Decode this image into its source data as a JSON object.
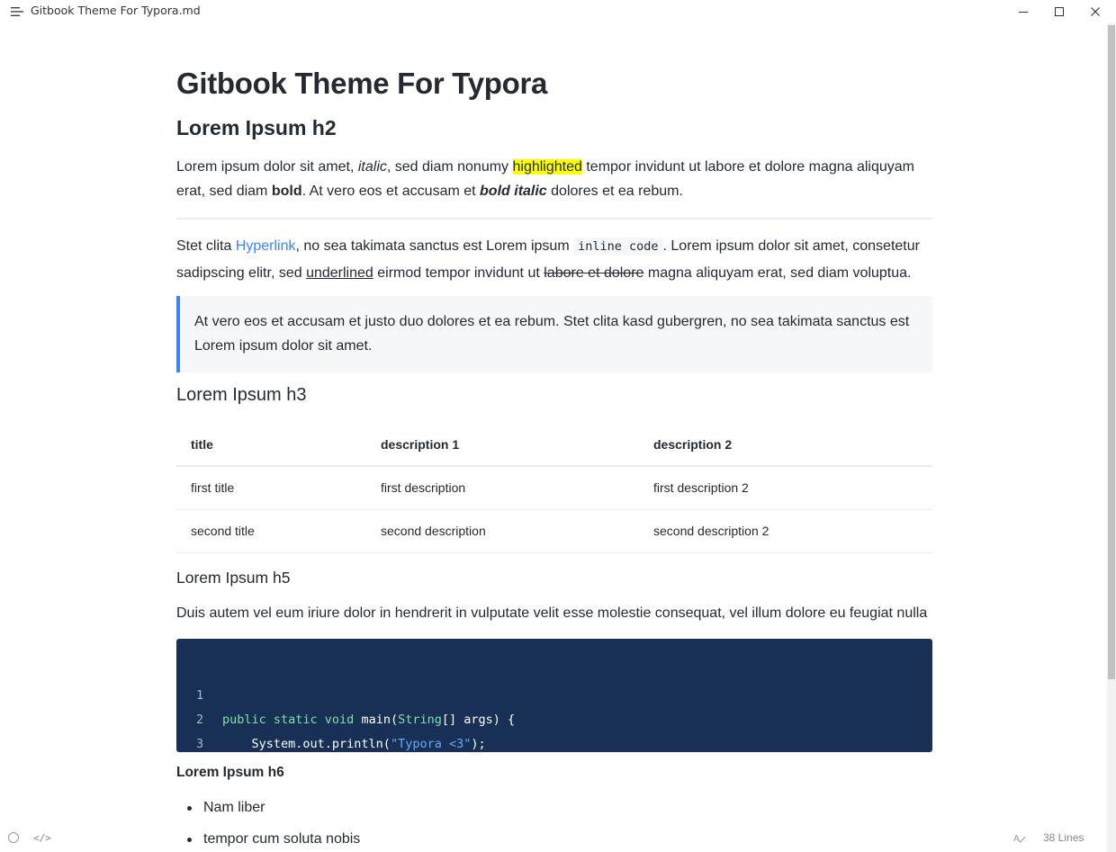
{
  "window": {
    "title": "Gitbook Theme For Typora.md",
    "minimize_icon": "minimize-icon",
    "maximize_icon": "maximize-icon",
    "close_icon": "close-icon"
  },
  "doc": {
    "h1": "Gitbook Theme For Typora",
    "h2": "Lorem Ipsum h2",
    "p1": {
      "a": "Lorem ipsum dolor sit amet, ",
      "italic": "italic",
      "b": ", sed diam nonumy ",
      "highlight": "highlighted",
      "c": " tempor invidunt ut labore et dolore magna aliquyam erat, sed diam ",
      "bold": "bold",
      "d": ". At vero eos et accusam et ",
      "bold_italic": "bold italic",
      "e": " dolores et ea rebum."
    },
    "p2": {
      "a": "Stet clita ",
      "link": "Hyperlink",
      "b": ", no sea takimata sanctus est Lorem ipsum ",
      "code": "inline code",
      "c": ". Lorem ipsum dolor sit amet, consetetur sadipscing elitr, sed ",
      "underline": "underlined",
      "d": " eirmod tempor invidunt ut ",
      "strike": "labore et dolore",
      "e": " magna aliquyam erat, sed diam voluptua."
    },
    "quote": "At vero eos et accusam et justo duo dolores et ea rebum. Stet clita kasd gubergren, no sea takimata sanctus est Lorem ipsum dolor sit amet.",
    "h3": "Lorem Ipsum h3",
    "table": {
      "headers": [
        "title",
        "description 1",
        "description 2"
      ],
      "rows": [
        [
          "first title",
          "first description",
          "first description 2"
        ],
        [
          "second title",
          "second description",
          "second description 2"
        ]
      ]
    },
    "h5": "Lorem Ipsum h5",
    "p3": "Duis autem vel eum iriure dolor in hendrerit in vulputate velit esse molestie consequat, vel illum dolore eu feugiat nulla",
    "code": {
      "line_numbers": [
        "1",
        "2",
        "3"
      ],
      "l1": {
        "kw": "public static void",
        "a": " main(",
        "type": "String",
        "b": "[] args) {"
      },
      "l2": {
        "a": "    System.out.println(",
        "str": "\"Typora <3\"",
        "b": ");"
      },
      "l3": "}"
    },
    "h6": "Lorem Ipsum h6",
    "list": [
      "Nam liber",
      "tempor cum soluta nobis"
    ]
  },
  "status": {
    "source_icon": "code-icon",
    "lines": "38 Lines"
  },
  "colors": {
    "accent": "#3884ff",
    "highlight": "#ffff00",
    "code_bg": "#183055"
  }
}
